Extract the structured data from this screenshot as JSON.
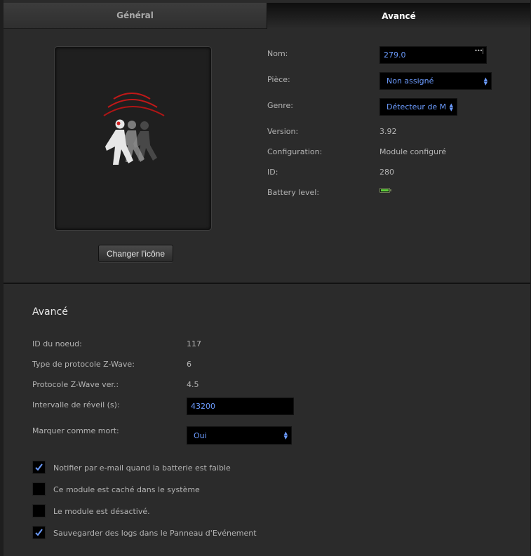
{
  "tabs": [
    {
      "label": "Général",
      "active": false
    },
    {
      "label": "Avancé",
      "active": true
    }
  ],
  "device": {
    "change_icon_label": "Changer l'icône",
    "fields": {
      "nom": {
        "label": "Nom:",
        "value": "279.0"
      },
      "piece": {
        "label": "Pièce:",
        "value": "Non assigné"
      },
      "genre": {
        "label": "Genre:",
        "value": "Détecteur de M"
      },
      "version": {
        "label": "Version:",
        "value": "3.92"
      },
      "configuration": {
        "label": "Configuration:",
        "value": "Module configuré"
      },
      "id": {
        "label": "ID:",
        "value": "280"
      },
      "battery": {
        "label": "Battery level:",
        "level_percent": 100,
        "color": "#5fd03a"
      }
    },
    "icon": "motion-sensor-walking-person-icon"
  },
  "advanced": {
    "title": "Avancé",
    "node_id": {
      "label": "ID du noeud:",
      "value": "117"
    },
    "protocol_type": {
      "label": "Type de protocole Z-Wave:",
      "value": "6"
    },
    "protocol_ver": {
      "label": "Protocole Z-Wave ver.:",
      "value": "4.5"
    },
    "wake_interval": {
      "label": "Intervalle de réveil (s):",
      "value": "43200"
    },
    "mark_dead": {
      "label": "Marquer comme mort:",
      "value": "Oui"
    },
    "checkboxes": [
      {
        "label": "Notifier par e-mail quand la batterie est faible",
        "checked": true
      },
      {
        "label": "Ce module est caché dans le système",
        "checked": false
      },
      {
        "label": "Le module est désactivé.",
        "checked": false
      },
      {
        "label": "Sauvegarder des logs dans le Panneau d'Evénement",
        "checked": true
      }
    ]
  },
  "colors": {
    "accent_text": "#6c9cff",
    "background": "#2b2b2b",
    "sensor_waves": "#c01818"
  }
}
